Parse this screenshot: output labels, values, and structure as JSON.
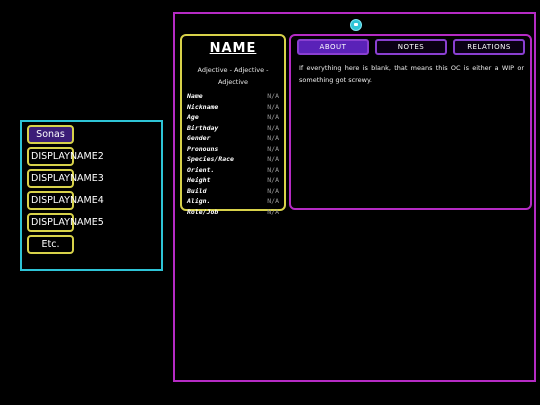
{
  "nav": {
    "items": [
      {
        "label": "Sonas",
        "active": true
      },
      {
        "label": "DISPLAYNAME2"
      },
      {
        "label": "DISPLAYNAME3"
      },
      {
        "label": "DISPLAYNAME4"
      },
      {
        "label": "DISPLAYNAME5"
      },
      {
        "label": "Etc."
      }
    ]
  },
  "profile": {
    "name": "NAME",
    "adjectives": "Adjective - Adjective - Adjective",
    "stats": [
      {
        "label": "Name",
        "value": "N/A"
      },
      {
        "label": "Nickname",
        "value": "N/A"
      },
      {
        "label": "Age",
        "value": "N/A"
      },
      {
        "label": "Birthday",
        "value": "N/A"
      },
      {
        "label": "Gender",
        "value": "N/A"
      },
      {
        "label": "Pronouns",
        "value": "N/A"
      },
      {
        "label": "Species/Race",
        "value": "N/A"
      },
      {
        "label": "Orient.",
        "value": "N/A"
      },
      {
        "label": "Height",
        "value": "N/A"
      },
      {
        "label": "Build",
        "value": "N/A"
      },
      {
        "label": "Align.",
        "value": "N/A"
      },
      {
        "label": "Role/Job",
        "value": "N/A"
      }
    ]
  },
  "tabs": [
    {
      "label": "ABOUT",
      "active": true
    },
    {
      "label": "NOTES"
    },
    {
      "label": "RELATIONS"
    }
  ],
  "about": {
    "text": "If everything here is blank, that means this OC is either a WIP or something got screwy."
  },
  "colors": {
    "background": "#000000",
    "nav_border": "#2ec4d6",
    "button_border": "#d8d24a",
    "frame_border": "#b52bc4",
    "tab_border": "#8a3fd1",
    "tab_active": "#5a22b8",
    "nav_active": "#3b1d78"
  },
  "icons": {
    "top_icon": "chat-bubble-icon"
  }
}
